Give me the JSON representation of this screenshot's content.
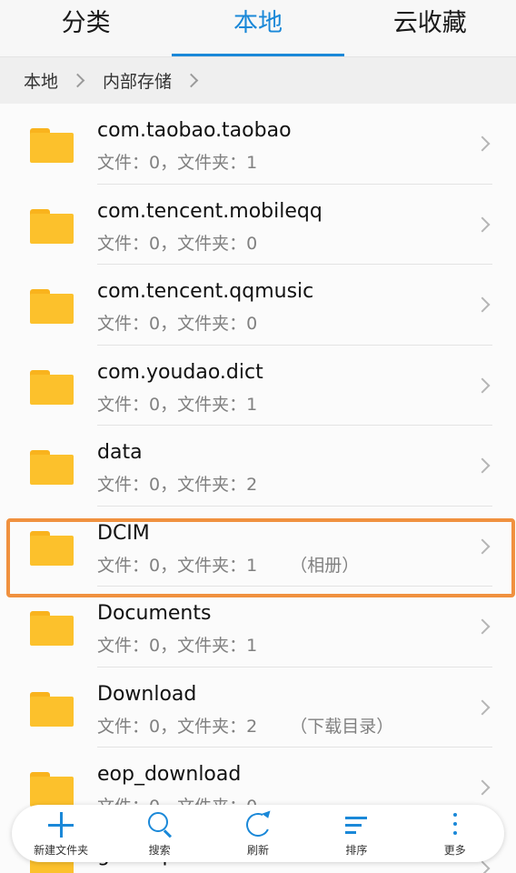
{
  "tabs": [
    {
      "label": "分类",
      "active": false
    },
    {
      "label": "本地",
      "active": true
    },
    {
      "label": "云收藏",
      "active": false
    }
  ],
  "breadcrumb": [
    "本地",
    "内部存储"
  ],
  "files": [
    {
      "name": "com.taobao.taobao",
      "meta": "文件：0，文件夹：1",
      "tag": ""
    },
    {
      "name": "com.tencent.mobileqq",
      "meta": "文件：0，文件夹：0",
      "tag": ""
    },
    {
      "name": "com.tencent.qqmusic",
      "meta": "文件：0，文件夹：0",
      "tag": ""
    },
    {
      "name": "com.youdao.dict",
      "meta": "文件：0，文件夹：1",
      "tag": ""
    },
    {
      "name": "data",
      "meta": "文件：0，文件夹：2",
      "tag": ""
    },
    {
      "name": "DCIM",
      "meta": "文件：0，文件夹：1",
      "tag": "（相册）"
    },
    {
      "name": "Documents",
      "meta": "文件：0，文件夹：1",
      "tag": ""
    },
    {
      "name": "Download",
      "meta": "文件：0，文件夹：2",
      "tag": "（下载目录）"
    },
    {
      "name": "eop_download",
      "meta": "文件：0，文件夹：0",
      "tag": ""
    },
    {
      "name": "gamerpk",
      "meta": "",
      "tag": ""
    }
  ],
  "toolbar": [
    {
      "label": "新建文件夹",
      "icon": "plus-icon"
    },
    {
      "label": "搜索",
      "icon": "search-icon"
    },
    {
      "label": "刷新",
      "icon": "refresh-icon"
    },
    {
      "label": "排序",
      "icon": "sort-icon"
    },
    {
      "label": "更多",
      "icon": "more-icon"
    }
  ],
  "colors": {
    "accent": "#1a88d8",
    "folder": "#fcc12c",
    "highlight": "#f0913f"
  }
}
